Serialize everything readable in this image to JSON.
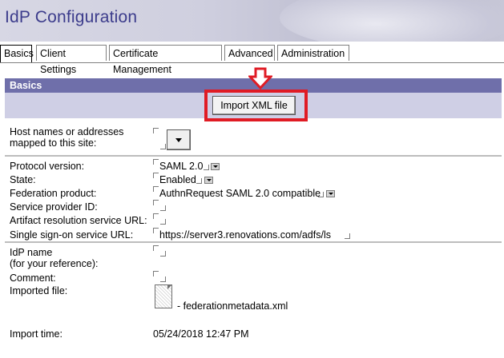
{
  "header": {
    "title": "IdP Configuration"
  },
  "tabs": [
    {
      "label": "Basics"
    },
    {
      "label": "Client Settings"
    },
    {
      "label": "Certificate Management"
    },
    {
      "label": "Advanced"
    },
    {
      "label": "Administration"
    }
  ],
  "section": {
    "title": "Basics"
  },
  "import_button": {
    "label": "Import XML file"
  },
  "host_names": {
    "label_line1": "Host names or addresses",
    "label_line2": "mapped to this site:"
  },
  "protocol": {
    "label": "Protocol version:",
    "value": "SAML 2.0"
  },
  "state": {
    "label": "State:",
    "value": "Enabled"
  },
  "federation": {
    "label": "Federation product:",
    "value": "AuthnRequest SAML 2.0 compatible"
  },
  "sp_id": {
    "label": "Service provider ID:"
  },
  "artifact": {
    "label": "Artifact resolution service URL:"
  },
  "sso": {
    "label": "Single sign-on service URL:",
    "value": "https://server3.renovations.com/adfs/ls"
  },
  "idp_name": {
    "label_line1": "IdP name",
    "label_line2": "(for your reference):"
  },
  "comment": {
    "label": "Comment:"
  },
  "imported_file": {
    "label": "Imported file:",
    "value": "- federationmetadata.xml"
  },
  "import_time": {
    "label": "Import time:",
    "value": "05/24/2018 12:47 PM"
  },
  "colors": {
    "highlight": "#e01b24",
    "section_bar": "#6f6faa",
    "title": "#3c3c8c"
  },
  "icons": [
    "down-arrow-icon",
    "dropdown-icon",
    "file-icon"
  ]
}
